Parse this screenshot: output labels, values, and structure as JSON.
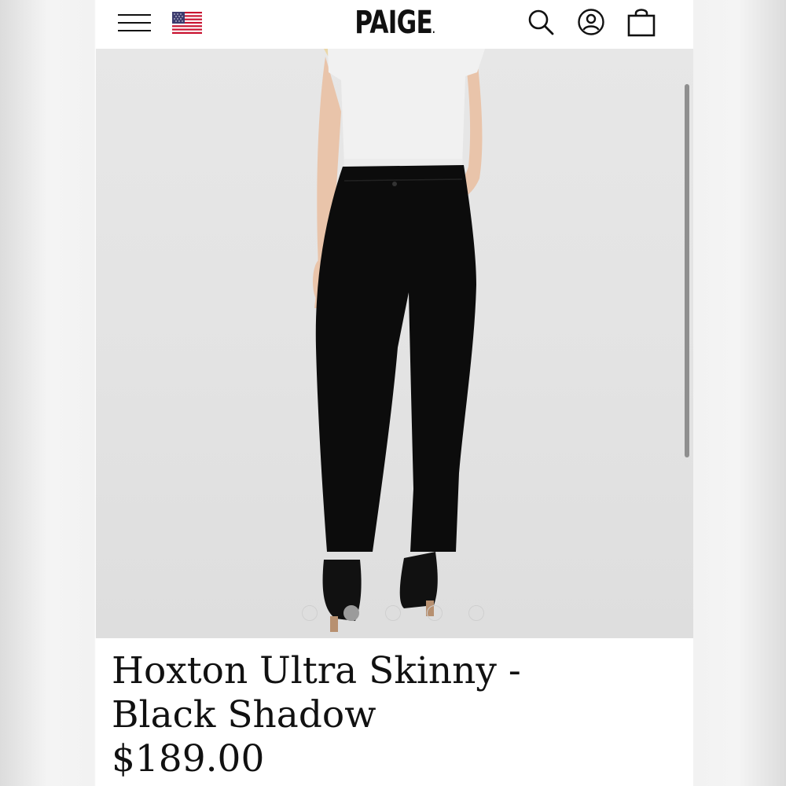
{
  "header": {
    "brand": "PAIGE",
    "brand_mark": ".",
    "icons": {
      "menu": "hamburger-menu-icon",
      "flag": "us-flag-icon",
      "search": "search-icon",
      "account": "account-icon",
      "bag": "shopping-bag-icon"
    }
  },
  "gallery": {
    "image_count": 5,
    "active_index": 1
  },
  "product": {
    "title_line1": "Hoxton Ultra Skinny -",
    "title_line2": "Black Shadow",
    "price": "$189.00"
  },
  "colors": {
    "text": "#111111",
    "hero_bg": "#e5e5e5",
    "dot_active": "#9b9b9b"
  }
}
